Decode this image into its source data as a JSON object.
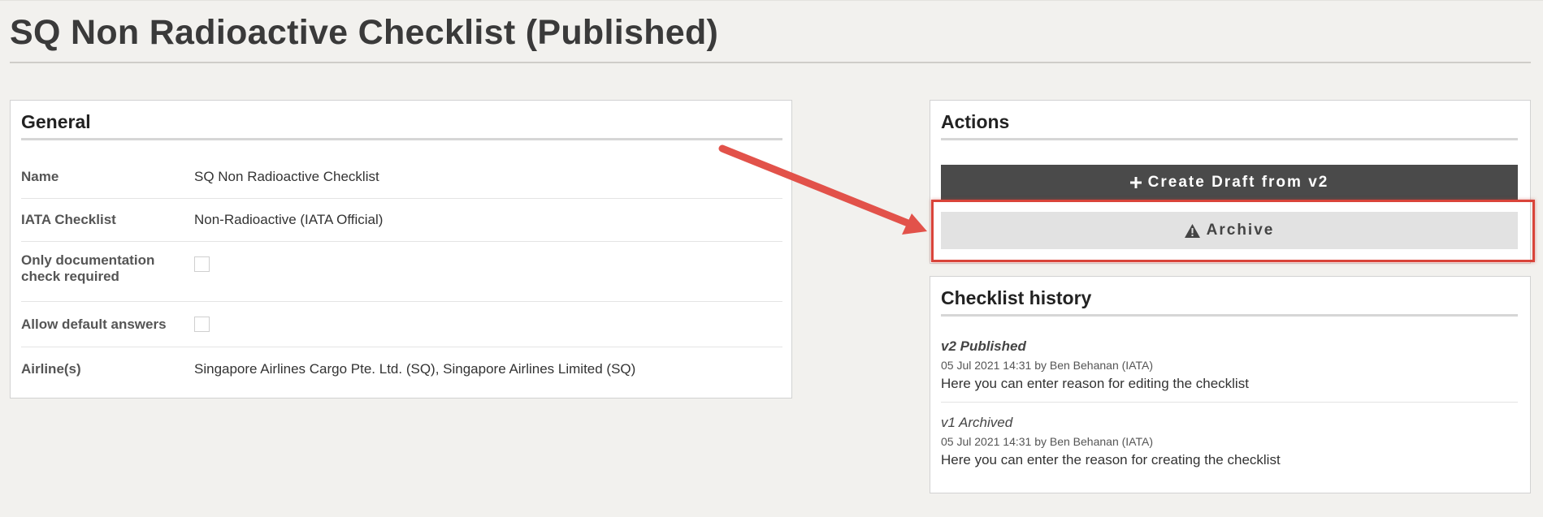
{
  "page": {
    "title": "SQ Non Radioactive Checklist (Published)"
  },
  "general": {
    "title": "General",
    "rows": [
      {
        "label": "Name",
        "value": "SQ Non Radioactive Checklist"
      },
      {
        "label": "IATA Checklist",
        "value": "Non-Radioactive (IATA Official)"
      },
      {
        "label_line1": "Only documentation",
        "label_line2": "check required",
        "checked": false
      },
      {
        "label": "Allow default answers",
        "checked": false
      },
      {
        "label": "Airline(s)",
        "value": "Singapore Airlines Cargo Pte. Ltd. (SQ), Singapore Airlines Limited (SQ)"
      }
    ]
  },
  "actions": {
    "title": "Actions",
    "create_icon": "plus-icon",
    "create_label": "Create Draft from v2",
    "archive_icon": "warning-triangle-icon",
    "archive_label": "Archive"
  },
  "history": {
    "title": "Checklist history",
    "items": [
      {
        "version": "v2 Published",
        "meta": "05 Jul 2021 14:31 by Ben Behanan (IATA)",
        "note": "Here you can enter reason for editing the checklist"
      },
      {
        "version": "v1 Archived",
        "meta": "05 Jul 2021 14:31 by Ben Behanan (IATA)",
        "note": "Here you can enter the reason for creating the checklist"
      }
    ]
  },
  "annotation": {
    "color": "#d9443a"
  }
}
